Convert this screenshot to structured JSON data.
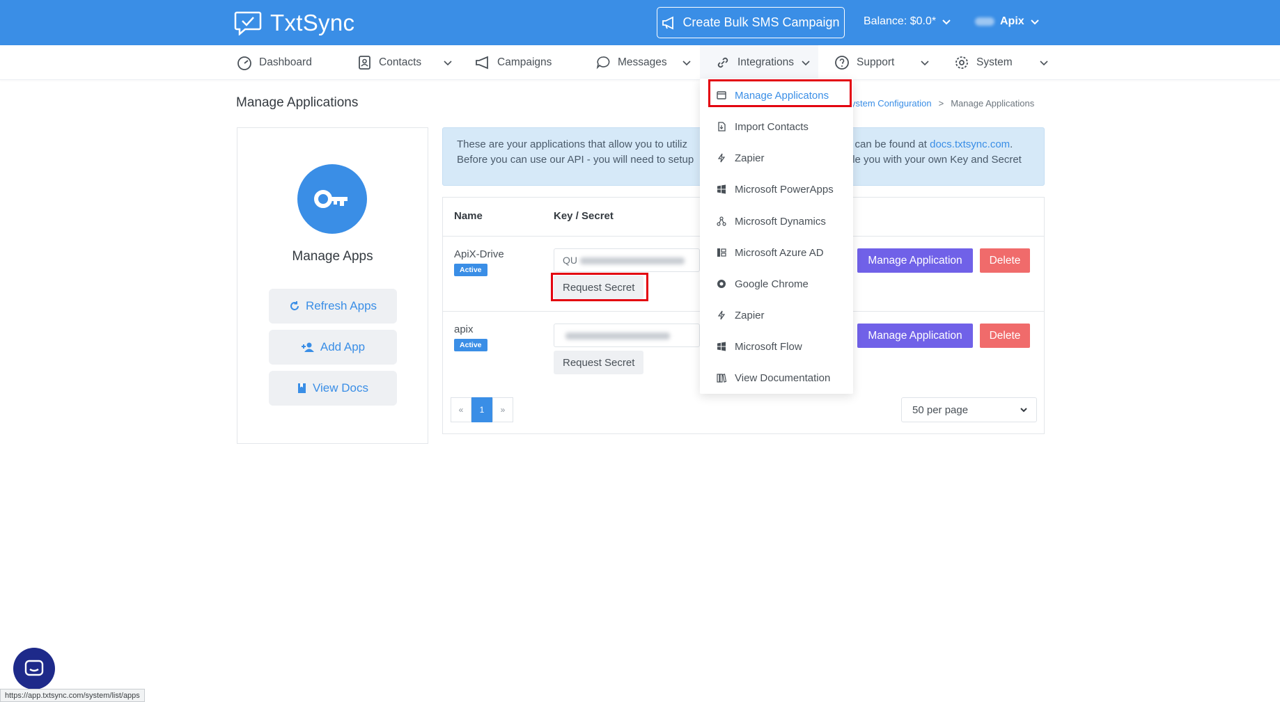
{
  "header": {
    "brand": "TxtSync",
    "bulk_button": "Create Bulk SMS Campaign",
    "balance": "Balance: $0.0*",
    "user": "Apix"
  },
  "nav": {
    "dashboard": "Dashboard",
    "contacts": "Contacts",
    "campaigns": "Campaigns",
    "messages": "Messages",
    "integrations": "Integrations",
    "support": "Support",
    "system": "System"
  },
  "page": {
    "title": "Manage Applications",
    "breadcrumb_link": "ystem Configuration",
    "breadcrumb_sep": ">",
    "breadcrumb_current": "Manage Applications"
  },
  "sidebar": {
    "title": "Manage Apps",
    "refresh": "Refresh Apps",
    "add": "Add App",
    "docs": "View Docs"
  },
  "info": {
    "line1_a": "These are your applications that allow you to utiliz",
    "line1_b": "n can be found at",
    "link": "docs.txtsync.com",
    "line1_c": ".",
    "line2_a": "Before you can use our API - you will need to setup",
    "line2_b": "le you with your own Key and Secret"
  },
  "table": {
    "col_name": "Name",
    "col_key": "Key / Secret",
    "rows": [
      {
        "name": "ApiX-Drive",
        "status": "Active",
        "key_prefix": "QU",
        "request": "Request Secret",
        "manage": "Manage Application",
        "delete": "Delete"
      },
      {
        "name": "apix",
        "status": "Active",
        "key_prefix": "",
        "request": "Request Secret",
        "manage": "Manage Application",
        "delete": "Delete"
      }
    ],
    "pager_prev": "«",
    "pager_current": "1",
    "pager_next": "»",
    "per_page": "50 per page"
  },
  "integrations_menu": {
    "items": [
      "Manage Applicatons",
      "Import Contacts",
      "Zapier",
      "Microsoft PowerApps",
      "Microsoft Dynamics",
      "Microsoft Azure AD",
      "Google Chrome",
      "Zapier",
      "Microsoft Flow",
      "View Documentation"
    ]
  },
  "status_url": "https://app.txtsync.com/system/list/apps",
  "colors": {
    "primary": "#3a8ee6",
    "manage": "#7061e8",
    "delete": "#f06b6b",
    "highlight": "#e3000f"
  }
}
